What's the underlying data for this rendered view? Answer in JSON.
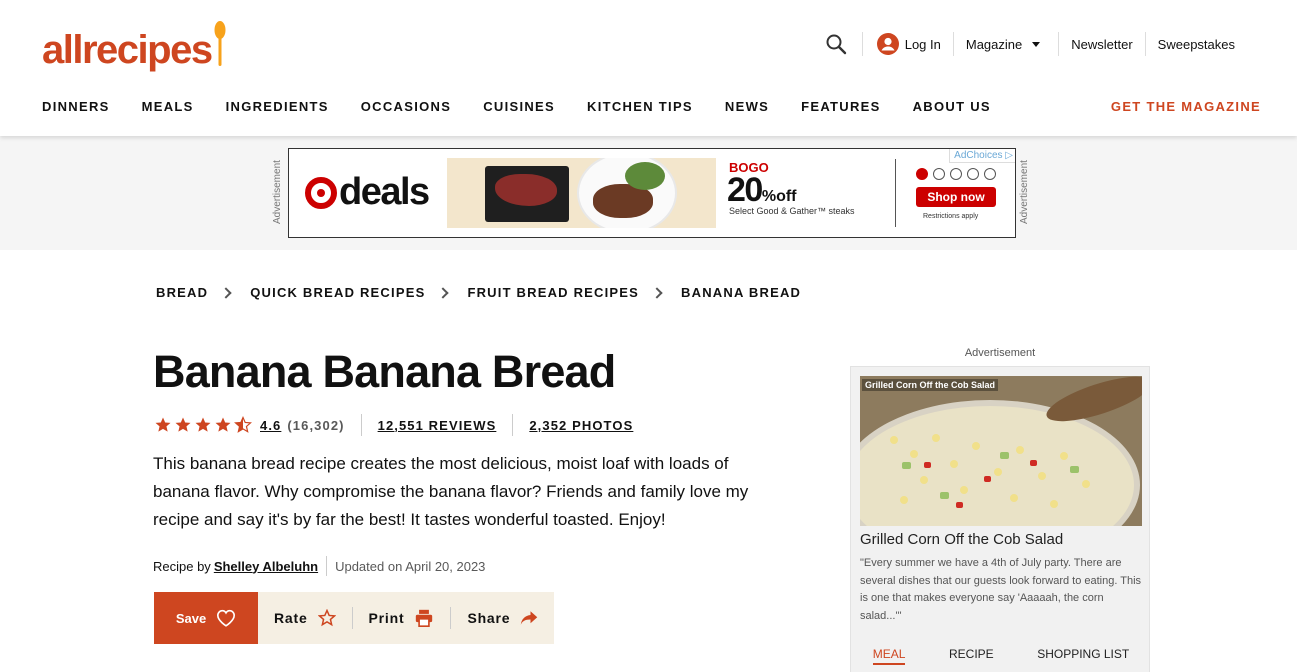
{
  "header": {
    "logo_text": "allrecipes",
    "brand_color": "#ce4620",
    "util": {
      "search_icon": "search-icon",
      "login_label": "Log In",
      "magazine_label": "Magazine",
      "newsletter_label": "Newsletter",
      "sweepstakes_label": "Sweepstakes"
    },
    "nav": [
      "DINNERS",
      "MEALS",
      "INGREDIENTS",
      "OCCASIONS",
      "CUISINES",
      "KITCHEN TIPS",
      "NEWS",
      "FEATURES",
      "ABOUT US"
    ],
    "cta_label": "GET THE MAGAZINE"
  },
  "ad_banner": {
    "side_label": "Advertisement",
    "deals_text": "deals",
    "bogo_text": "BOGO",
    "pct_text": "20",
    "pct_suffix": "%",
    "off_text": "off",
    "select_text": "Select Good & Gather™ steaks",
    "adchoices_text": "AdChoices",
    "shop_now_label": "Shop now",
    "restrictions_text": "Restrictions apply",
    "accent_color": "#cc0000"
  },
  "breadcrumbs": [
    "BREAD",
    "QUICK BREAD RECIPES",
    "FRUIT BREAD RECIPES",
    "BANANA BREAD"
  ],
  "recipe": {
    "title": "Banana Banana Bread",
    "rating_value": "4.6",
    "rating_count": "(16,302)",
    "stars": 4.5,
    "reviews_label": "12,551 REVIEWS",
    "photos_label": "2,352 PHOTOS",
    "description": "This banana bread recipe creates the most delicious, moist loaf with loads of banana flavor. Why compromise the banana flavor? Friends and family love my recipe and say it's by far the best! It tastes wonderful toasted. Enjoy!",
    "byline_prefix": "Recipe by",
    "author": "Shelley Albeluhn",
    "updated": "Updated on April 20, 2023"
  },
  "actions": {
    "save_label": "Save",
    "rate_label": "Rate",
    "print_label": "Print",
    "share_label": "Share"
  },
  "side_ad": {
    "label": "Advertisement",
    "image_tag": "Grilled Corn Off the Cob Salad",
    "title": "Grilled Corn Off the Cob Salad",
    "quote": "\"Every summer we have a 4th of July party. There are several dishes that our guests look forward to eating. This is one that makes everyone say 'Aaaaah, the corn salad...'\"",
    "tabs": [
      "MEAL",
      "RECIPE",
      "SHOPPING LIST"
    ]
  }
}
